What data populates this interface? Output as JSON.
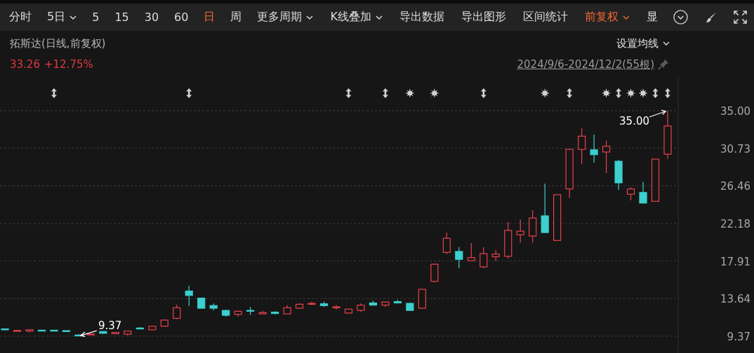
{
  "toolbar": {
    "periods": [
      {
        "label": "分时",
        "selected": false,
        "dropdown": false
      },
      {
        "label": "5日",
        "selected": false,
        "dropdown": true
      },
      {
        "label": "5",
        "selected": false,
        "dropdown": false
      },
      {
        "label": "15",
        "selected": false,
        "dropdown": false
      },
      {
        "label": "30",
        "selected": false,
        "dropdown": false
      },
      {
        "label": "60",
        "selected": false,
        "dropdown": false
      },
      {
        "label": "日",
        "selected": true,
        "dropdown": false
      },
      {
        "label": "周",
        "selected": false,
        "dropdown": false
      },
      {
        "label": "更多周期",
        "selected": false,
        "dropdown": true
      }
    ],
    "tools": [
      {
        "label": "K线叠加",
        "dropdown": true,
        "active": false
      },
      {
        "label": "导出数据",
        "dropdown": false,
        "active": false
      },
      {
        "label": "导出图形",
        "dropdown": false,
        "active": false
      },
      {
        "label": "区间统计",
        "dropdown": false,
        "active": false
      },
      {
        "label": "前复权",
        "dropdown": true,
        "active": true
      },
      {
        "label": "显",
        "dropdown": false,
        "active": false
      }
    ]
  },
  "stock": {
    "title": "拓斯达(日线,前复权)",
    "price": "33.26",
    "change": "+12.75%"
  },
  "ma_settings": {
    "label": "设置均线"
  },
  "range": {
    "label": "2024/9/6-2024/12/2(55根)"
  },
  "event_row": [
    {
      "kind": "none"
    },
    {
      "kind": "none"
    },
    {
      "kind": "none"
    },
    {
      "kind": "none"
    },
    {
      "kind": "split"
    },
    {
      "kind": "none"
    },
    {
      "kind": "none"
    },
    {
      "kind": "none"
    },
    {
      "kind": "none"
    },
    {
      "kind": "none"
    },
    {
      "kind": "none"
    },
    {
      "kind": "none"
    },
    {
      "kind": "none"
    },
    {
      "kind": "none"
    },
    {
      "kind": "none"
    },
    {
      "kind": "split"
    },
    {
      "kind": "none"
    },
    {
      "kind": "none"
    },
    {
      "kind": "none"
    },
    {
      "kind": "none"
    },
    {
      "kind": "none"
    },
    {
      "kind": "none"
    },
    {
      "kind": "none"
    },
    {
      "kind": "none"
    },
    {
      "kind": "none"
    },
    {
      "kind": "none"
    },
    {
      "kind": "none"
    },
    {
      "kind": "none"
    },
    {
      "kind": "split"
    },
    {
      "kind": "none"
    },
    {
      "kind": "none"
    },
    {
      "kind": "split"
    },
    {
      "kind": "none"
    },
    {
      "kind": "notice"
    },
    {
      "kind": "none"
    },
    {
      "kind": "notice"
    },
    {
      "kind": "none"
    },
    {
      "kind": "none"
    },
    {
      "kind": "none"
    },
    {
      "kind": "split"
    },
    {
      "kind": "none"
    },
    {
      "kind": "none"
    },
    {
      "kind": "none"
    },
    {
      "kind": "none"
    },
    {
      "kind": "notice"
    },
    {
      "kind": "none"
    },
    {
      "kind": "split"
    },
    {
      "kind": "none"
    },
    {
      "kind": "none"
    },
    {
      "kind": "notice"
    },
    {
      "kind": "split"
    },
    {
      "kind": "notice"
    },
    {
      "kind": "notice"
    },
    {
      "kind": "split"
    },
    {
      "kind": "split"
    }
  ],
  "chart_data": {
    "type": "candlestick",
    "categories": [
      null,
      null,
      null,
      null,
      null,
      null,
      null,
      null,
      null,
      null,
      null,
      null,
      null,
      null,
      null,
      null,
      null,
      null,
      null,
      null,
      null,
      null,
      null,
      null,
      null,
      null,
      null,
      null,
      null,
      null,
      null,
      null,
      null,
      null,
      null,
      null,
      null,
      null,
      null,
      null,
      null,
      null,
      null,
      null,
      null,
      null,
      null,
      null,
      null,
      null,
      null,
      null,
      null,
      null,
      null
    ],
    "yticks": [
      {
        "value": 35.0,
        "label": "35.00"
      },
      {
        "value": 30.73,
        "label": "30.73"
      },
      {
        "value": 26.46,
        "label": "26.46"
      },
      {
        "value": 22.18,
        "label": "22.18"
      },
      {
        "value": 17.91,
        "label": "17.91"
      },
      {
        "value": 13.64,
        "label": "13.64"
      },
      {
        "value": 9.37,
        "label": "9.37"
      }
    ],
    "ohlc": [
      [
        10.2,
        10.25,
        10.05,
        10.1
      ],
      [
        10.0,
        10.05,
        9.95,
        10.02
      ],
      [
        9.95,
        10.15,
        9.8,
        10.1
      ],
      [
        10.05,
        10.1,
        9.95,
        10.03
      ],
      [
        10.05,
        10.08,
        9.95,
        9.98
      ],
      [
        10.0,
        10.02,
        9.88,
        9.9
      ],
      [
        9.5,
        9.6,
        9.37,
        9.48
      ],
      [
        9.55,
        9.65,
        9.5,
        9.62
      ],
      [
        9.9,
        9.95,
        9.65,
        9.7
      ],
      [
        9.65,
        9.8,
        9.6,
        9.8
      ],
      [
        9.6,
        10.0,
        9.45,
        9.95
      ],
      [
        10.3,
        10.4,
        10.15,
        10.2
      ],
      [
        10.1,
        10.5,
        10.05,
        10.5
      ],
      [
        10.5,
        11.25,
        10.45,
        11.2
      ],
      [
        11.4,
        12.95,
        11.3,
        12.6
      ],
      [
        14.5,
        15.1,
        12.8,
        14.0
      ],
      [
        13.7,
        13.75,
        12.5,
        12.55
      ],
      [
        12.85,
        13.1,
        12.3,
        12.55
      ],
      [
        12.3,
        12.35,
        11.6,
        11.75
      ],
      [
        11.85,
        12.3,
        11.6,
        12.2
      ],
      [
        12.3,
        12.7,
        11.8,
        12.25
      ],
      [
        11.9,
        12.25,
        11.85,
        12.05
      ],
      [
        12.1,
        12.2,
        11.85,
        11.95
      ],
      [
        11.9,
        12.9,
        11.85,
        12.6
      ],
      [
        12.55,
        13.1,
        12.5,
        13.0
      ],
      [
        13.0,
        13.3,
        12.9,
        13.1
      ],
      [
        13.05,
        13.3,
        12.7,
        12.85
      ],
      [
        12.6,
        12.9,
        12.4,
        12.7
      ],
      [
        12.0,
        12.5,
        11.95,
        12.45
      ],
      [
        12.3,
        13.1,
        12.1,
        12.9
      ],
      [
        13.15,
        13.4,
        12.9,
        12.9
      ],
      [
        12.9,
        13.3,
        12.7,
        13.25
      ],
      [
        13.3,
        13.5,
        13.1,
        13.15
      ],
      [
        13.1,
        13.2,
        12.25,
        12.3
      ],
      [
        12.55,
        14.7,
        12.5,
        14.7
      ],
      [
        15.6,
        17.6,
        15.5,
        17.55
      ],
      [
        18.9,
        21.15,
        18.7,
        20.5
      ],
      [
        19.0,
        19.5,
        17.1,
        18.1
      ],
      [
        17.95,
        19.95,
        17.9,
        18.3
      ],
      [
        17.25,
        19.5,
        17.1,
        18.75
      ],
      [
        18.4,
        19.15,
        17.9,
        18.7
      ],
      [
        18.45,
        22.35,
        18.2,
        21.4
      ],
      [
        20.9,
        22.65,
        20.0,
        21.3
      ],
      [
        20.75,
        23.7,
        20.0,
        22.8
      ],
      [
        23.05,
        26.7,
        21.1,
        21.15
      ],
      [
        20.25,
        25.45,
        20.25,
        25.45
      ],
      [
        26.1,
        30.6,
        25.1,
        30.6
      ],
      [
        30.6,
        33.0,
        28.95,
        32.1
      ],
      [
        30.55,
        32.3,
        29.1,
        30.0
      ],
      [
        30.3,
        31.6,
        27.9,
        30.95
      ],
      [
        29.25,
        29.4,
        26.0,
        26.8
      ],
      [
        25.5,
        26.3,
        24.8,
        26.1
      ],
      [
        25.7,
        26.9,
        24.5,
        24.5
      ],
      [
        24.7,
        29.5,
        24.7,
        29.5
      ],
      [
        30.05,
        35.0,
        29.5,
        33.26
      ]
    ],
    "ylim": [
      7.46,
      38.82
    ],
    "grid": true,
    "annotations": [
      "35.00",
      "9.37"
    ]
  }
}
